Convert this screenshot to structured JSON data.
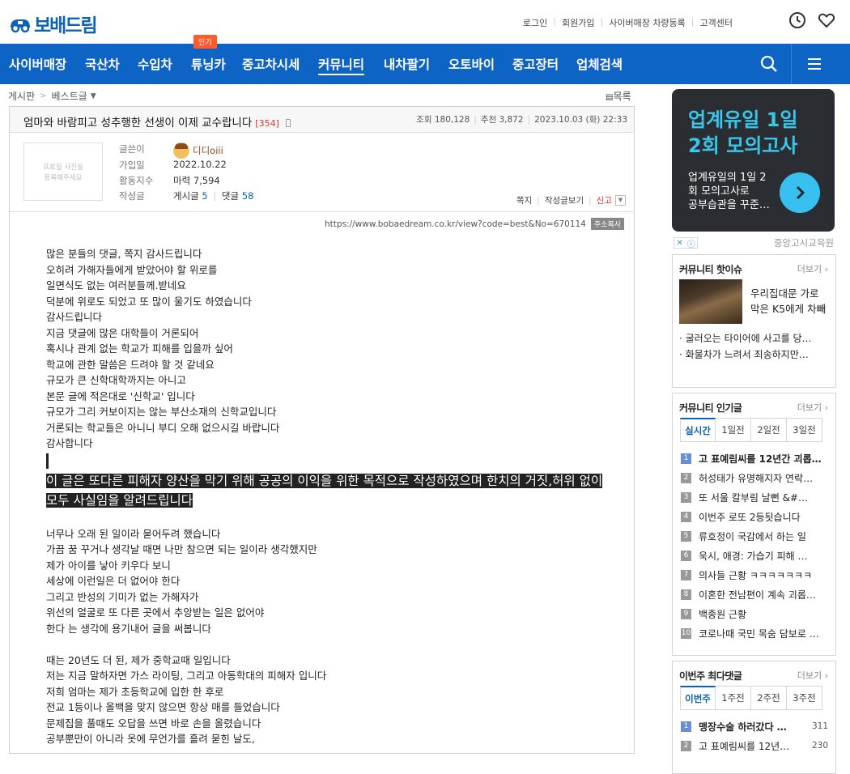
{
  "header": {
    "logo_text": "보배드림",
    "top_links": [
      "로그인",
      "회원가입",
      "사이버매장 차량등록",
      "고객센터"
    ],
    "icons": [
      "clock-icon",
      "heart-icon"
    ]
  },
  "nav": {
    "items": [
      "사이버매장",
      "국산차",
      "수입차",
      "튜닝카",
      "중고차시세",
      "커뮤니티",
      "내차팔기",
      "오토바이",
      "중고장터",
      "업체검색"
    ],
    "active": "커뮤니티",
    "hot_badge": "인기",
    "bg_color": "#0e64c4"
  },
  "breadcrumb": {
    "board": "게시판",
    "sub": "베스트글",
    "list_label": "목록"
  },
  "post": {
    "title": "엄마와 바람피고 성추행한 선생이 이제 교수랍니다",
    "comment_count": "[354]",
    "views_label": "조회",
    "views": "180,128",
    "likes_label": "추천",
    "likes": "3,872",
    "date": "2023.10.03 (화) 22:33",
    "profile_placeholder": [
      "프로필 사진을",
      "등록해주세요"
    ],
    "author": {
      "label_writer": "글쓴이",
      "nickname": "디디oiii",
      "label_joined": "가입일",
      "joined": "2022.10.22",
      "label_activity": "활동지수",
      "activity": "마력 7,594",
      "label_posts": "작성글",
      "posts_label": "게시글",
      "posts": "5",
      "replies_label": "댓글",
      "replies": "58"
    },
    "actions": [
      "쪽지",
      "작성글보기",
      "신고"
    ],
    "url": "https://www.bobaedream.co.kr/view?code=best&No=670114",
    "copy_label": "주소복사",
    "body_top": [
      "많은 분들의 댓글, 쪽지 감사드립니다",
      "오히려 가해자들에게 받았어야 할 위로를",
      "일면식도 없는 여러분들께.받네요",
      "덕분에 위로도 되었고 또 많이 울기도 하였습니다",
      "감사드립니다",
      "지금 댓글에 많은 대학들이 거론되어",
      "혹시나 관계 없는 학교가 피해를 입을까 싶어",
      "학교에 관한 말씀은 드려야 할 것 같네요",
      "규모가 큰 신학대학까지는 아니고",
      "본문 글에 적은대로 '신학교' 입니다",
      "규모가 그리 커보이지는 않는 부산소재의 신학교입니다",
      "거론되는 학교들은 아니니 부디 오해 없으시길 바랍니다",
      "감사합니다"
    ],
    "highlight": "이 글은 또다른 피해자 양산을 막기 위해 공공의 이익을 위한 목적으로 작성하였으며 한치의 거짓,허위 없이 모두 사실임을 알려드립니다",
    "body_mid": [
      "너무나 오래 된 일이라 묻어두려 했습니다",
      "가끔 꿈 꾸거나 생각날 때면 나만 참으면 되는 일이라 생각했지만",
      "제가 아이를 낳아 키우다 보니",
      "세상에 이런일은 더 없어야 한다",
      "그리고 반성의 기미가 없는 가해자가",
      "위선의 얼굴로 또 다른 곳에서 추앙받는 일은 없어야",
      "한다 는 생각에 용기내어 글을 써봅니다"
    ],
    "body_bottom": [
      "때는 20년도 더 된, 제가 중학교때 일입니다",
      "저는 지금 말하자면 가스 라이팅, 그리고 아동학대의 피해자 입니다",
      "저희 엄마는 제가 초등학교에 입한 한 후로",
      "전교 1등이나 올백을 맞지 않으면 항상 매를 들었습니다",
      "문제집을 풀때도 오답을 쓰면 바로 손을 올렸습니다",
      "공부뿐만이 아니라 옷에 무언가를 흘려 묻힌 날도,"
    ]
  },
  "sidebar": {
    "ad": {
      "title_line1": "업계유일 1일",
      "title_line2": "2회 모의고사",
      "sub_line1": "업계유일의 1일 2",
      "sub_line2": "회 모의고사로",
      "sub_line3": "공부습관을 꾸준…",
      "advertiser": "중앙고시교육원",
      "accent": "#38c0f0"
    },
    "hot_issue": {
      "title": "커뮤니티 핫이슈",
      "more": "더보기",
      "feature_line1": "우리집대문 가로",
      "feature_line2": "막은 K5에게 차빼",
      "bullets": [
        "· 굴러오는 타이어에 사고를 당…",
        "· 화물차가 느려서 죄송하지만…"
      ]
    },
    "popular": {
      "title": "커뮤니티 인기글",
      "more": "더보기",
      "tabs": [
        "실시간",
        "1일전",
        "2일전",
        "3일전"
      ],
      "items": [
        "고 표예림씨를 12년간 괴롭…",
        "허성태가 유명해지자 연락…",
        "또 서울 칼부림 날뻔 &#…",
        "이번주 로또 2등됫습니다",
        "류호정이 국감에서 하는 일",
        "욱시, 애경: 가습기 피해 …",
        "의사들 근황 ㅋㅋㅋㅋㅋㅋㅋ",
        "이혼한 전남편이 계속 괴롭…",
        "백종원 근황",
        "코로나때 국민 목숨 담보로 …"
      ]
    },
    "weekly": {
      "title": "이번주 최다댓글",
      "more": "더보기",
      "tabs": [
        "이번주",
        "1주전",
        "2주전",
        "3주전"
      ],
      "items": [
        {
          "text": "맹장수술 하러갔다 …",
          "count": "311"
        },
        {
          "text": "고 표예림씨를 12년…",
          "count": "230"
        }
      ]
    }
  }
}
